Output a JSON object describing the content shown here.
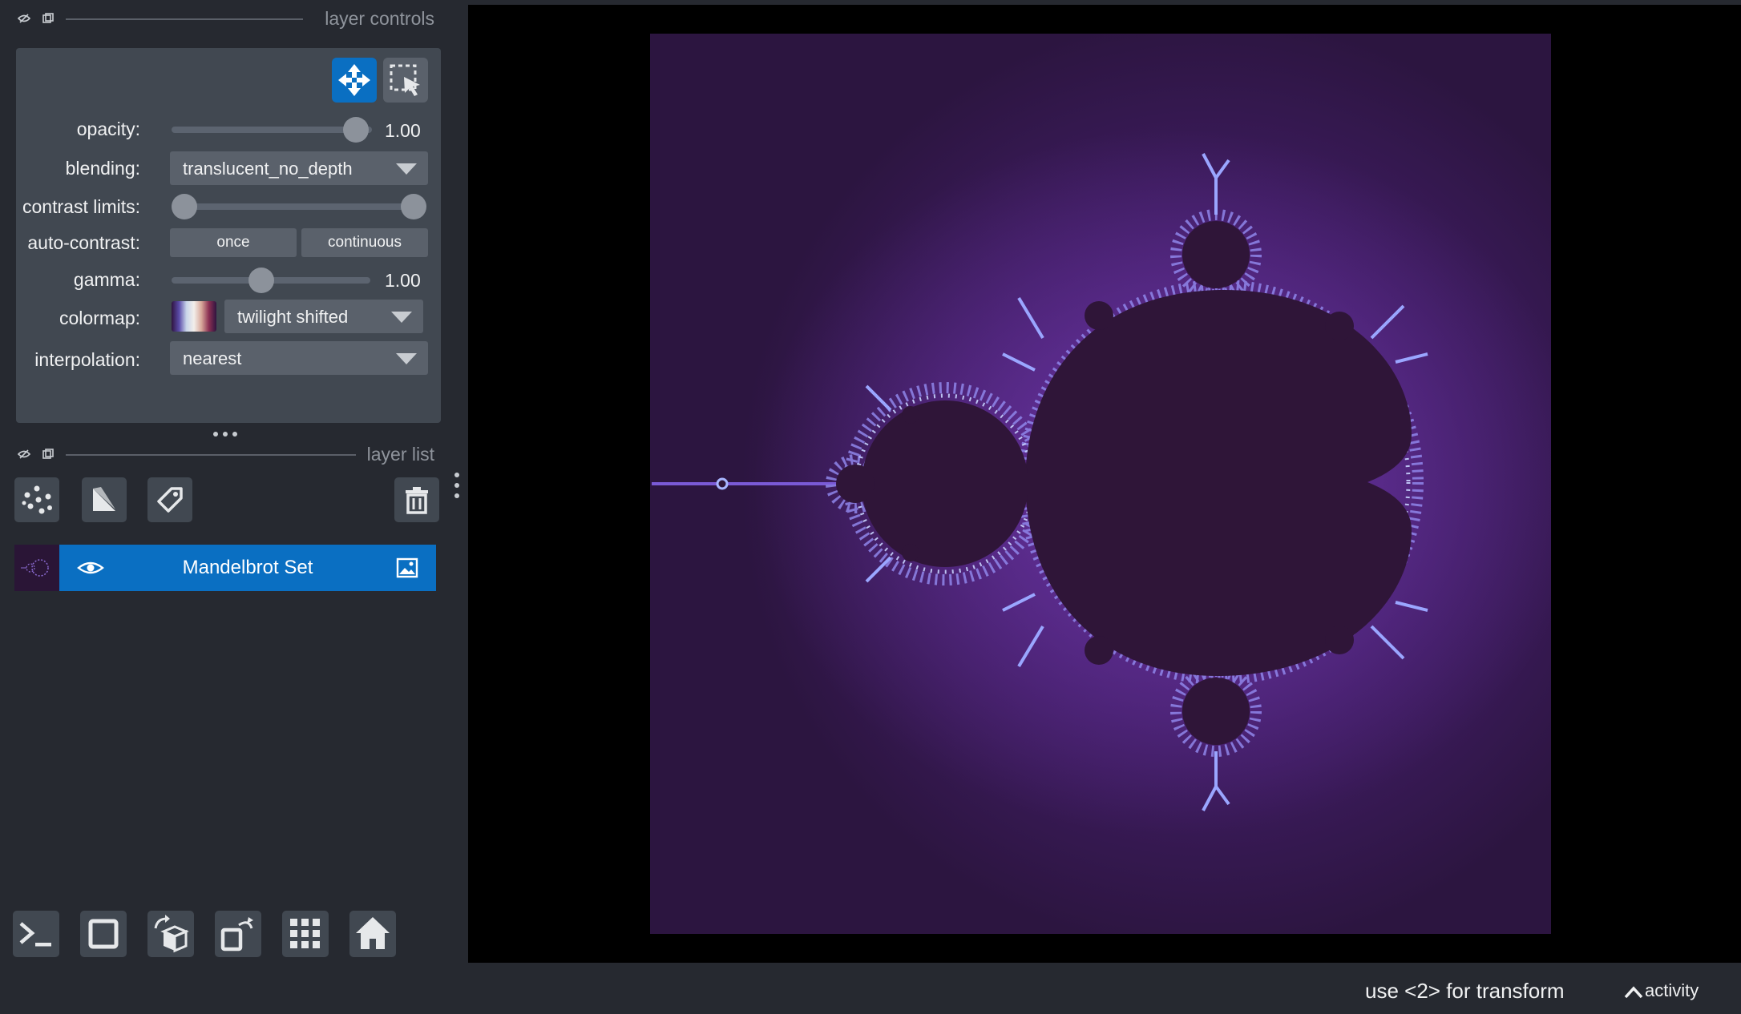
{
  "layer_controls": {
    "title": "layer controls",
    "opacity": {
      "label": "opacity:",
      "value": "1.00",
      "level": 1.0
    },
    "blending": {
      "label": "blending:",
      "value": "translucent_no_depth"
    },
    "contrast_limits": {
      "label": "contrast limits:",
      "low": 0.0,
      "high": 1.0
    },
    "auto_contrast": {
      "label": "auto-contrast:",
      "once": "once",
      "continuous": "continuous"
    },
    "gamma": {
      "label": "gamma:",
      "value": "1.00",
      "level": 0.45
    },
    "colormap": {
      "label": "colormap:",
      "value": "twilight shifted"
    },
    "interpolation": {
      "label": "interpolation:",
      "value": "nearest"
    }
  },
  "layer_list": {
    "title": "layer list",
    "layers": [
      {
        "name": "Mandelbrot Set",
        "visible": true,
        "selected": true,
        "type_icon": "image-icon"
      }
    ]
  },
  "status": {
    "message": "use <2> for transform",
    "activity": "activity"
  },
  "colors": {
    "accent": "#0a6fc2",
    "panel": "#414851",
    "background": "#262930",
    "image_bg": "#2b1538",
    "set_interior": "#2f1538"
  }
}
